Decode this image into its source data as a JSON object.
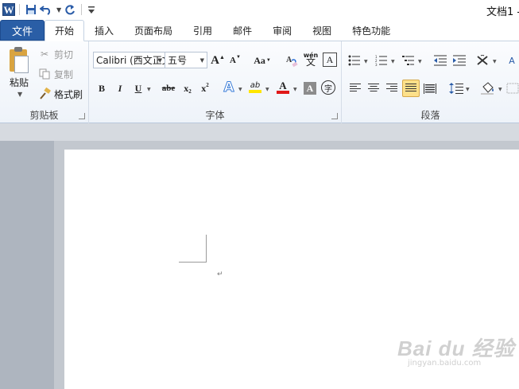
{
  "window": {
    "app_logo": "W",
    "title": "文档1 -"
  },
  "quick_access": {
    "save_icon": "floppy-disk-icon",
    "undo_icon": "undo-icon",
    "redo_icon": "redo-icon",
    "customize_icon": "customize-dropdown-icon"
  },
  "tabs": {
    "file": "文件",
    "items": [
      "开始",
      "插入",
      "页面布局",
      "引用",
      "邮件",
      "审阅",
      "视图",
      "特色功能"
    ],
    "active_index": 0
  },
  "clipboard": {
    "paste": "粘贴",
    "cut": "剪切",
    "copy": "复制",
    "format_painter": "格式刷",
    "group_label": "剪贴板"
  },
  "font": {
    "font_name": "Calibri (西文正文)",
    "font_size": "五号",
    "grow": "A",
    "shrink": "A",
    "change_case": "Aa",
    "clear_format_glyph": "A",
    "phonetic_glyph": "wén",
    "phonetic_char": "文",
    "border_char": "A",
    "bold": "B",
    "italic": "I",
    "underline": "U",
    "strike": "abe",
    "subscript": "x",
    "superscript": "x",
    "text_effect": "A",
    "highlight": "ab",
    "font_color": "A",
    "char_shading": "A",
    "enclose_char": "字",
    "group_label": "字体"
  },
  "paragraph": {
    "group_label": "段落"
  },
  "colors": {
    "file_tab_bg": "#2a5ea6",
    "highlight_yellow": "#ffe600",
    "font_color_red": "#e01818",
    "selected_justify_bg": "#fde08a"
  },
  "watermark": {
    "text": "Bai du 经验",
    "sub": "jingyan.baidu.com"
  }
}
